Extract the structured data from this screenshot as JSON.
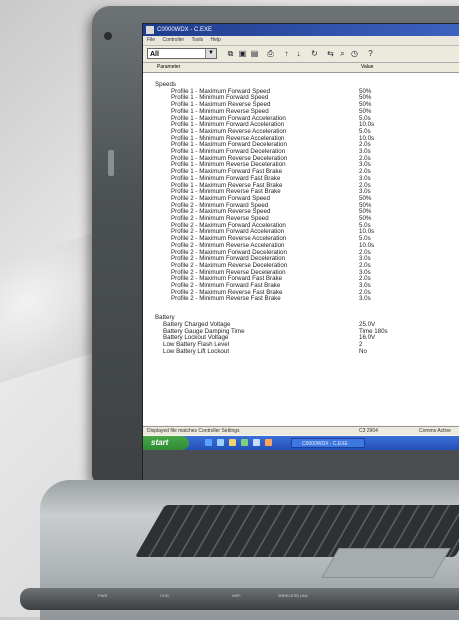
{
  "window": {
    "title": "C0000WDX - C.EXE",
    "menu": [
      "File",
      "Controller",
      "Tools",
      "Help"
    ]
  },
  "toolbar": {
    "combo_value": "All",
    "icons": [
      "copy-icon",
      "save-icon",
      "save-as-icon",
      "print-icon",
      "sort-up-icon",
      "sort-down-icon",
      "refresh-icon",
      "connect-icon",
      "search-icon",
      "clock-icon",
      "help-icon"
    ]
  },
  "columns": {
    "parameter": "Parameter",
    "value": "Value"
  },
  "groups": [
    {
      "title": "Speeds",
      "rows": [
        [
          "Profile 1 - Maximum Forward Speed",
          "50%"
        ],
        [
          "Profile 1 - Minimum Forward Speed",
          "50%"
        ],
        [
          "Profile 1 - Maximum Reverse Speed",
          "50%"
        ],
        [
          "Profile 1 - Minimum Reverse Speed",
          "50%"
        ],
        [
          "Profile 1 - Maximum Forward Acceleration",
          "5.0s"
        ],
        [
          "Profile 1 - Minimum Forward Acceleration",
          "10.0s"
        ],
        [
          "Profile 1 - Maximum Reverse Acceleration",
          "5.0s"
        ],
        [
          "Profile 1 - Minimum Reverse Acceleration",
          "10.0s"
        ],
        [
          "Profile 1 - Maximum Forward Deceleration",
          "2.0s"
        ],
        [
          "Profile 1 - Minimum Forward Deceleration",
          "3.0s"
        ],
        [
          "Profile 1 - Maximum Reverse Deceleration",
          "2.0s"
        ],
        [
          "Profile 1 - Minimum Reverse Deceleration",
          "3.0s"
        ],
        [
          "Profile 1 - Maximum Forward Fast Brake",
          "2.0s"
        ],
        [
          "Profile 1 - Minimum Forward Fast Brake",
          "3.0s"
        ],
        [
          "Profile 1 - Maximum Reverse Fast Brake",
          "2.0s"
        ],
        [
          "Profile 1 - Minimum Reverse Fast Brake",
          "3.0s"
        ],
        [
          "Profile 2 - Maximum Forward Speed",
          "50%"
        ],
        [
          "Profile 2 - Minimum Forward Speed",
          "50%"
        ],
        [
          "Profile 2 - Maximum Reverse Speed",
          "50%"
        ],
        [
          "Profile 2 - Minimum Reverse Speed",
          "50%"
        ],
        [
          "Profile 2 - Maximum Forward Acceleration",
          "5.0s"
        ],
        [
          "Profile 2 - Minimum Forward Acceleration",
          "10.0s"
        ],
        [
          "Profile 2 - Maximum Reverse Acceleration",
          "5.0s"
        ],
        [
          "Profile 2 - Minimum Reverse Acceleration",
          "10.0s"
        ],
        [
          "Profile 2 - Maximum Forward Deceleration",
          "2.0s"
        ],
        [
          "Profile 2 - Minimum Forward Deceleration",
          "3.0s"
        ],
        [
          "Profile 2 - Maximum Reverse Deceleration",
          "2.0s"
        ],
        [
          "Profile 2 - Minimum Reverse Deceleration",
          "3.0s"
        ],
        [
          "Profile 2 - Maximum Forward Fast Brake",
          "2.0s"
        ],
        [
          "Profile 2 - Minimum Forward Fast Brake",
          "3.0s"
        ],
        [
          "Profile 2 - Maximum Reverse Fast Brake",
          "2.0s"
        ],
        [
          "Profile 2 - Minimum Reverse Fast Brake",
          "3.0s"
        ]
      ]
    },
    {
      "title": "Battery",
      "rows": [
        [
          "Battery Charged Voltage",
          "25.0V"
        ],
        [
          "Battery Gauge Damping Time",
          "Time 180s"
        ],
        [
          "Battery Lockout Voltage",
          "16.0V"
        ],
        [
          "Low Battery Flash Level",
          "2"
        ],
        [
          "Low Battery Lift Lockout",
          "No"
        ]
      ]
    }
  ],
  "status": {
    "left": "Displayed file matches Controller Settings",
    "middle": "C3 2904",
    "right": "Comms Active"
  },
  "taskbar": {
    "start_label": "start",
    "task_label": "C0000WDX - C.EXE"
  },
  "laptop": {
    "front_labels": [
      "PWR",
      "CHG",
      "WIFI",
      "WIRELESS LAN"
    ]
  }
}
